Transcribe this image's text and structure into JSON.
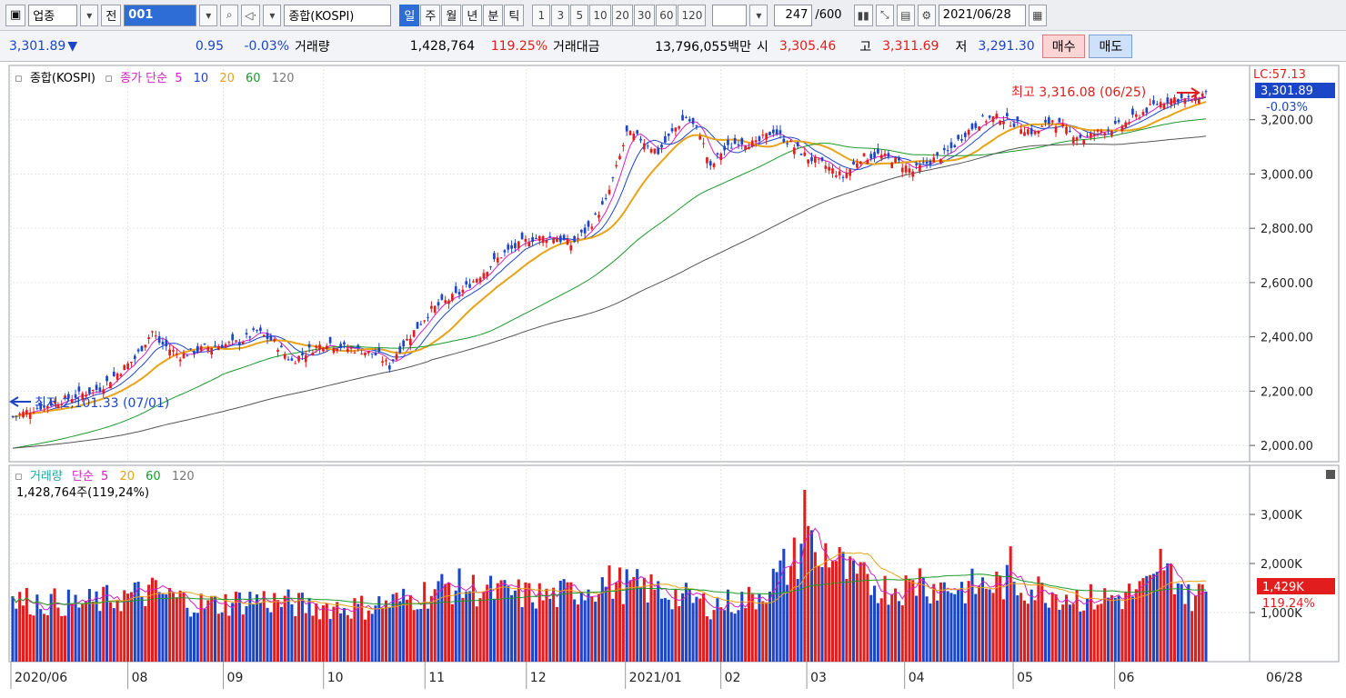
{
  "toolbar": {
    "category_label": "업종",
    "all_label": "전",
    "code_value": "001",
    "index_name": "종합(KOSPI)",
    "period_tabs": [
      "일",
      "주",
      "월",
      "년",
      "분",
      "틱"
    ],
    "active_period": "일",
    "interval_buttons": [
      "1",
      "3",
      "5",
      "10",
      "20",
      "30",
      "60",
      "120"
    ],
    "count_value": "247",
    "count_total": "/600",
    "date_value": "2021/06/28"
  },
  "quote": {
    "price": "3,301.89",
    "change": "0.95",
    "change_pct": "-0.03%",
    "volume_label": "거래량",
    "volume": "1,428,764",
    "volume_ratio": "119.25%",
    "amount_label": "거래대금",
    "amount": "13,796,055백만",
    "open_label": "시",
    "open": "3,305.46",
    "high_label": "고",
    "high": "3,311.69",
    "low_label": "저",
    "low": "3,291.30",
    "buy_label": "매수",
    "sell_label": "매도"
  },
  "colors": {
    "up": "#e11d1d",
    "down": "#1c46c8",
    "ma5": "#d21fc4",
    "ma10": "#1c46c8",
    "ma20": "#e8a317",
    "ma60": "#1b9a2c",
    "ma120": "#555555"
  },
  "chart_data": [
    {
      "type": "candlestick",
      "legend": {
        "index": "종합(KOSPI)",
        "series": "종가 단순",
        "periods": [
          "5",
          "10",
          "20",
          "60",
          "120"
        ]
      },
      "ylim": [
        1940,
        3400
      ],
      "yticks": [
        "2,000.00",
        "2,200.00",
        "2,400.00",
        "2,600.00",
        "2,800.00",
        "3,000.00",
        "3,200.00"
      ],
      "ytick_values": [
        2000,
        2200,
        2400,
        2600,
        2800,
        3000,
        3200
      ],
      "lc_label": "LC:57.13",
      "last_price_label": "3,301.89",
      "last_change_label": "-0.03%",
      "max_annotation": "최고 3,316.08 (06/25)",
      "min_annotation": "최저 2,101.33 (07/01)",
      "x_labels": [
        "2020/06",
        "08",
        "09",
        "10",
        "11",
        "12",
        "2021/01",
        "02",
        "03",
        "04",
        "05",
        "06",
        "06/28"
      ],
      "x_label_fracs": [
        0.0,
        0.098,
        0.178,
        0.262,
        0.347,
        0.432,
        0.515,
        0.595,
        0.667,
        0.749,
        0.84,
        0.925,
        1.0
      ],
      "anchors": [
        [
          0,
          2105
        ],
        [
          5,
          2130
        ],
        [
          15,
          2170
        ],
        [
          25,
          2210
        ],
        [
          35,
          2320
        ],
        [
          40,
          2420
        ],
        [
          42,
          2380
        ],
        [
          48,
          2330
        ],
        [
          55,
          2360
        ],
        [
          65,
          2380
        ],
        [
          70,
          2420
        ],
        [
          75,
          2380
        ],
        [
          80,
          2310
        ],
        [
          85,
          2350
        ],
        [
          90,
          2380
        ],
        [
          95,
          2360
        ],
        [
          100,
          2350
        ],
        [
          105,
          2330
        ],
        [
          108,
          2290
        ],
        [
          110,
          2340
        ],
        [
          115,
          2420
        ],
        [
          120,
          2500
        ],
        [
          128,
          2560
        ],
        [
          135,
          2640
        ],
        [
          140,
          2700
        ],
        [
          148,
          2760
        ],
        [
          155,
          2770
        ],
        [
          160,
          2740
        ],
        [
          165,
          2800
        ],
        [
          170,
          2900
        ],
        [
          173,
          3020
        ],
        [
          176,
          3150
        ],
        [
          180,
          3130
        ],
        [
          185,
          3080
        ],
        [
          190,
          3170
        ],
        [
          193,
          3210
        ],
        [
          197,
          3150
        ],
        [
          200,
          3020
        ],
        [
          203,
          3080
        ],
        [
          208,
          3120
        ],
        [
          213,
          3110
        ],
        [
          218,
          3160
        ],
        [
          223,
          3110
        ],
        [
          228,
          3060
        ],
        [
          233,
          3030
        ],
        [
          238,
          2990
        ],
        [
          243,
          3060
        ],
        [
          248,
          3070
        ],
        [
          253,
          3050
        ],
        [
          258,
          3010
        ],
        [
          262,
          3040
        ],
        [
          268,
          3080
        ],
        [
          273,
          3150
        ],
        [
          278,
          3200
        ],
        [
          283,
          3210
        ],
        [
          288,
          3180
        ],
        [
          293,
          3150
        ],
        [
          298,
          3200
        ],
        [
          302,
          3160
        ],
        [
          307,
          3130
        ],
        [
          312,
          3160
        ],
        [
          318,
          3180
        ],
        [
          323,
          3220
        ],
        [
          328,
          3260
        ],
        [
          333,
          3280
        ],
        [
          338,
          3270
        ],
        [
          342,
          3300
        ]
      ],
      "ma60_start": 1990,
      "ma120_start": 1990
    },
    {
      "type": "bar",
      "legend": {
        "name": "거래량",
        "series": "단순",
        "periods": [
          "5",
          "20",
          "60",
          "120"
        ]
      },
      "summary_label": "1,428,764주(119,24%)",
      "ylim": [
        0,
        4000
      ],
      "yticks": [
        "1,000K",
        "2,000K",
        "3,000K"
      ],
      "ytick_values": [
        1000,
        2000,
        3000
      ],
      "last_value_label": "1,429K",
      "last_ratio_label": "119.24%",
      "anchors": [
        [
          0,
          1250
        ],
        [
          20,
          1180
        ],
        [
          40,
          1420
        ],
        [
          55,
          1150
        ],
        [
          70,
          1280
        ],
        [
          85,
          1130
        ],
        [
          100,
          1110
        ],
        [
          112,
          1250
        ],
        [
          125,
          1550
        ],
        [
          140,
          1400
        ],
        [
          155,
          1320
        ],
        [
          170,
          1620
        ],
        [
          185,
          1450
        ],
        [
          200,
          1150
        ],
        [
          212,
          1280
        ],
        [
          222,
          1900
        ],
        [
          228,
          2450
        ],
        [
          234,
          2200
        ],
        [
          240,
          1750
        ],
        [
          250,
          1500
        ],
        [
          262,
          1550
        ],
        [
          272,
          1500
        ],
        [
          285,
          1600
        ],
        [
          298,
          1420
        ],
        [
          308,
          1280
        ],
        [
          318,
          1320
        ],
        [
          325,
          1500
        ],
        [
          333,
          1800
        ],
        [
          337,
          1300
        ],
        [
          342,
          1429
        ]
      ],
      "spikes": [
        [
          221,
          2300
        ],
        [
          227,
          3500
        ],
        [
          231,
          1950
        ],
        [
          260,
          1900
        ],
        [
          286,
          2350
        ],
        [
          329,
          2300
        ]
      ]
    }
  ]
}
